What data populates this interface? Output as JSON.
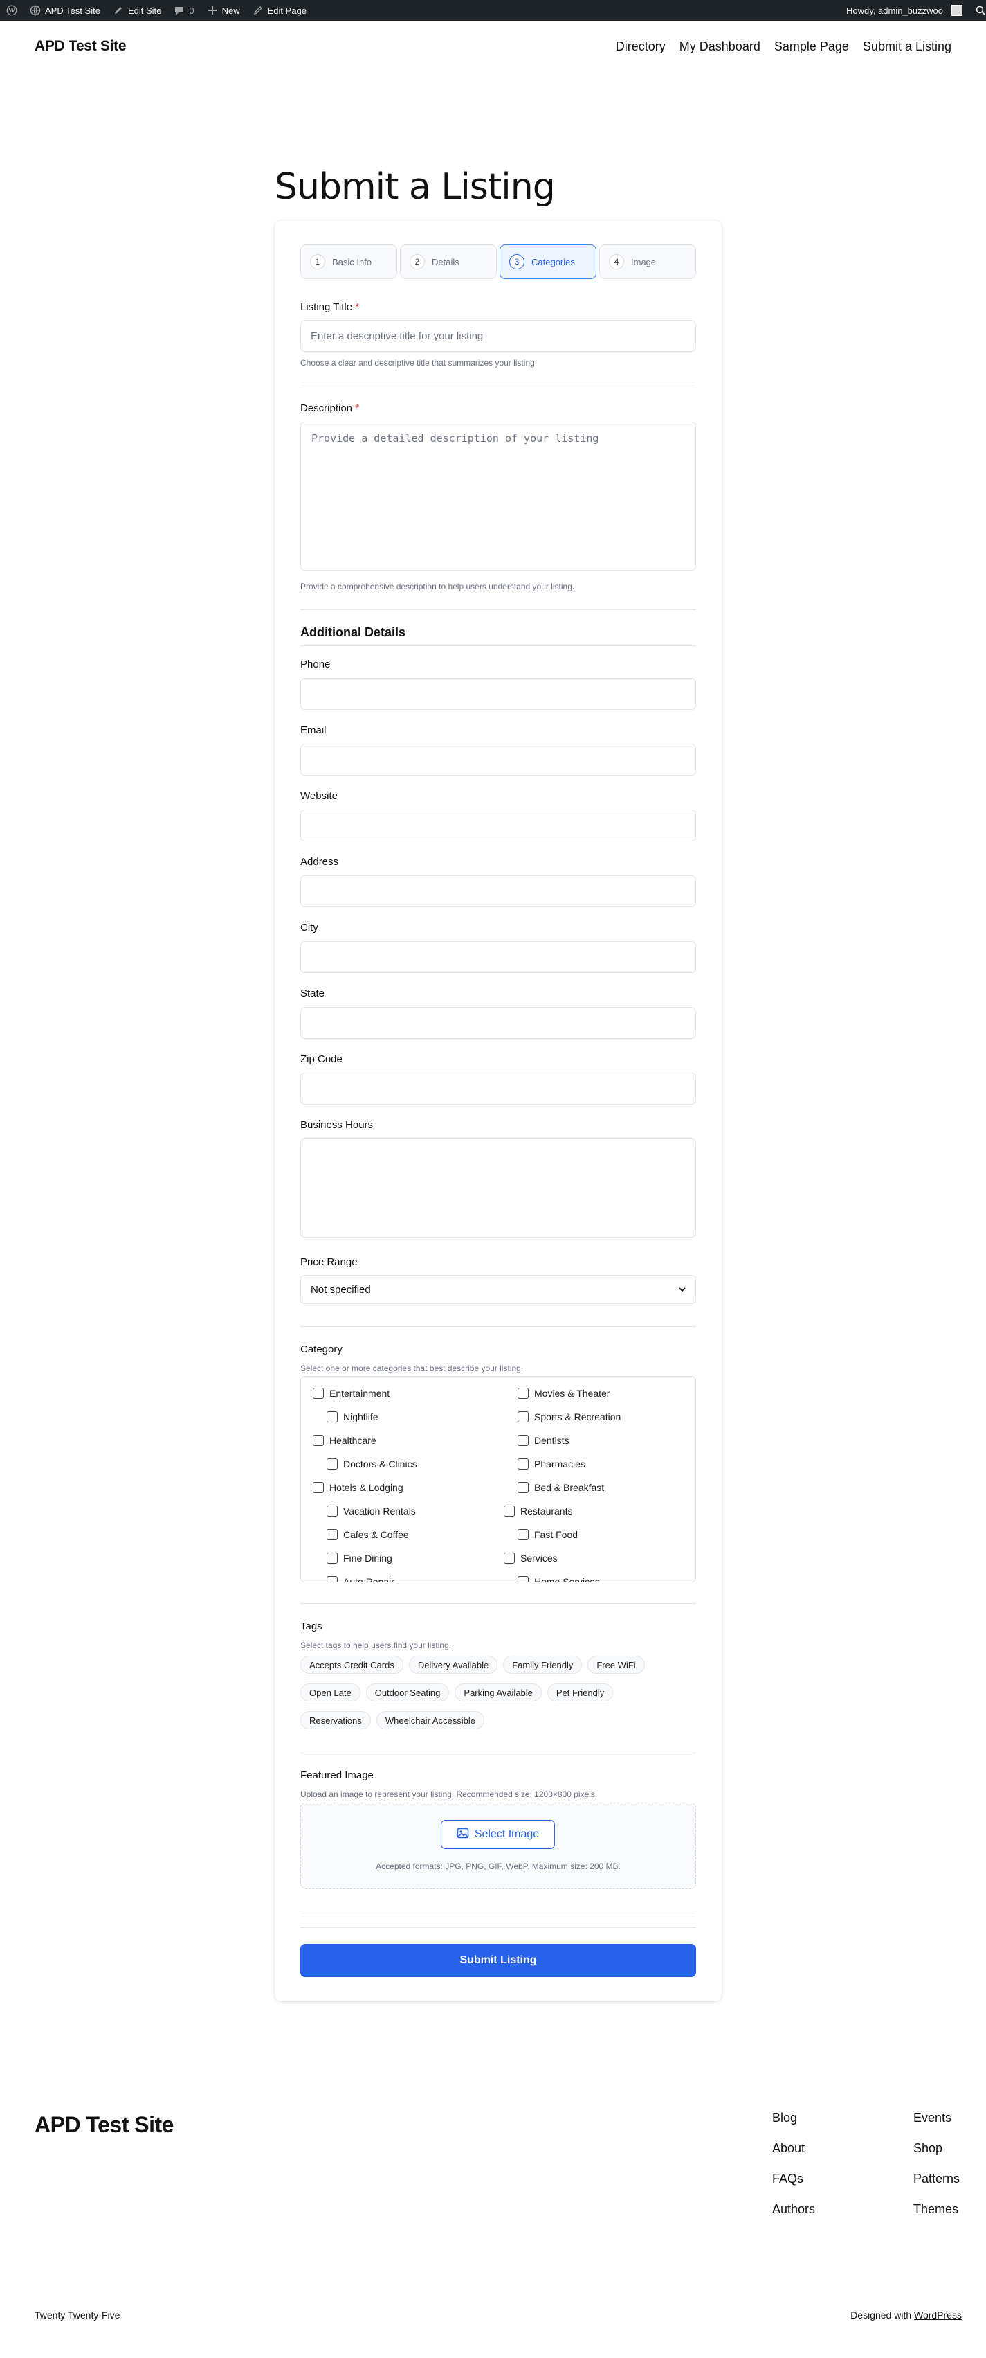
{
  "admin_bar": {
    "site_name": "APD Test Site",
    "edit_site": "Edit Site",
    "comments_count": "0",
    "new": "New",
    "edit_page": "Edit Page",
    "howdy": "Howdy, admin_buzzwoo"
  },
  "header": {
    "site_title": "APD Test Site",
    "nav": [
      "Directory",
      "My Dashboard",
      "Sample Page",
      "Submit a Listing"
    ]
  },
  "page": {
    "title": "Submit a Listing"
  },
  "steps": [
    {
      "num": "1",
      "label": "Basic Info"
    },
    {
      "num": "2",
      "label": "Details"
    },
    {
      "num": "3",
      "label": "Categories"
    },
    {
      "num": "4",
      "label": "Image"
    }
  ],
  "form": {
    "title_label": "Listing Title",
    "title_placeholder": "Enter a descriptive title for your listing",
    "title_help": "Choose a clear and descriptive title that summarizes your listing.",
    "description_label": "Description",
    "description_placeholder": "Provide a detailed description of your listing",
    "description_help": "Provide a comprehensive description to help users understand your listing.",
    "additional_title": "Additional Details",
    "phone_label": "Phone",
    "email_label": "Email",
    "website_label": "Website",
    "address_label": "Address",
    "city_label": "City",
    "state_label": "State",
    "zip_label": "Zip Code",
    "hours_label": "Business Hours",
    "price_label": "Price Range",
    "price_value": "Not specified",
    "category_label": "Category",
    "category_help": "Select one or more categories that best describe your listing.",
    "categories": [
      "Entertainment",
      "Movies & Theater",
      "Nightlife",
      "Sports & Recreation",
      "Healthcare",
      "Dentists",
      "Doctors & Clinics",
      "Pharmacies",
      "Hotels & Lodging",
      "Bed & Breakfast",
      "Vacation Rentals",
      "Restaurants",
      "Cafes & Coffee",
      "Fast Food",
      "Fine Dining",
      "Services",
      "Auto Repair",
      "Home Services"
    ],
    "tags_label": "Tags",
    "tags_help": "Select tags to help users find your listing.",
    "tags": [
      "Accepts Credit Cards",
      "Delivery Available",
      "Family Friendly",
      "Free WiFi",
      "Open Late",
      "Outdoor Seating",
      "Parking Available",
      "Pet Friendly",
      "Reservations",
      "Wheelchair Accessible"
    ],
    "image_label": "Featured Image",
    "image_help": "Upload an image to represent your listing. Recommended size: 1200×800 pixels.",
    "select_image": "Select Image",
    "formats": "Accepted formats: JPG, PNG, GIF, WebP. Maximum size: 200 MB.",
    "submit": "Submit Listing",
    "required_mark": "*"
  },
  "footer": {
    "title": "APD Test Site",
    "col1": [
      "Blog",
      "About",
      "FAQs",
      "Authors"
    ],
    "col2": [
      "Events",
      "Shop",
      "Patterns",
      "Themes"
    ],
    "theme": "Twenty Twenty-Five",
    "designed_with": "Designed with",
    "wordpress": "WordPress"
  },
  "colors": {
    "accent": "#2563eb",
    "admin_bar": "#1d2327",
    "required": "#dc2626"
  }
}
